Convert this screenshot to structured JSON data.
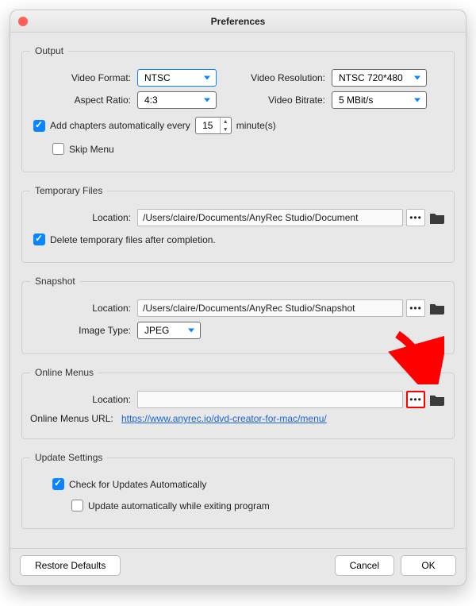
{
  "window": {
    "title": "Preferences"
  },
  "output": {
    "legend": "Output",
    "videoFormatLabel": "Video Format:",
    "videoFormat": "NTSC",
    "videoResolutionLabel": "Video Resolution:",
    "videoResolution": "NTSC 720*480",
    "aspectRatioLabel": "Aspect Ratio:",
    "aspectRatio": "4:3",
    "videoBitrateLabel": "Video Bitrate:",
    "videoBitrate": "5 MBit/s",
    "addChaptersLabel": "Add chapters automatically every",
    "addChaptersValue": "15",
    "addChaptersUnit": "minute(s)",
    "skipMenuLabel": "Skip Menu"
  },
  "temp": {
    "legend": "Temporary Files",
    "locationLabel": "Location:",
    "location": "/Users/claire/Documents/AnyRec Studio/Document",
    "deleteLabel": "Delete temporary files after completion."
  },
  "snapshot": {
    "legend": "Snapshot",
    "locationLabel": "Location:",
    "location": "/Users/claire/Documents/AnyRec Studio/Snapshot",
    "imageTypeLabel": "Image Type:",
    "imageType": "JPEG"
  },
  "onlineMenus": {
    "legend": "Online Menus",
    "locationLabel": "Location:",
    "location": "",
    "urlLabel": "Online Menus URL:",
    "url": "https://www.anyrec.io/dvd-creator-for-mac/menu/"
  },
  "update": {
    "legend": "Update Settings",
    "checkLabel": "Check for Updates Automatically",
    "autoLabel": "Update automatically while exiting program"
  },
  "footer": {
    "restore": "Restore Defaults",
    "cancel": "Cancel",
    "ok": "OK"
  }
}
